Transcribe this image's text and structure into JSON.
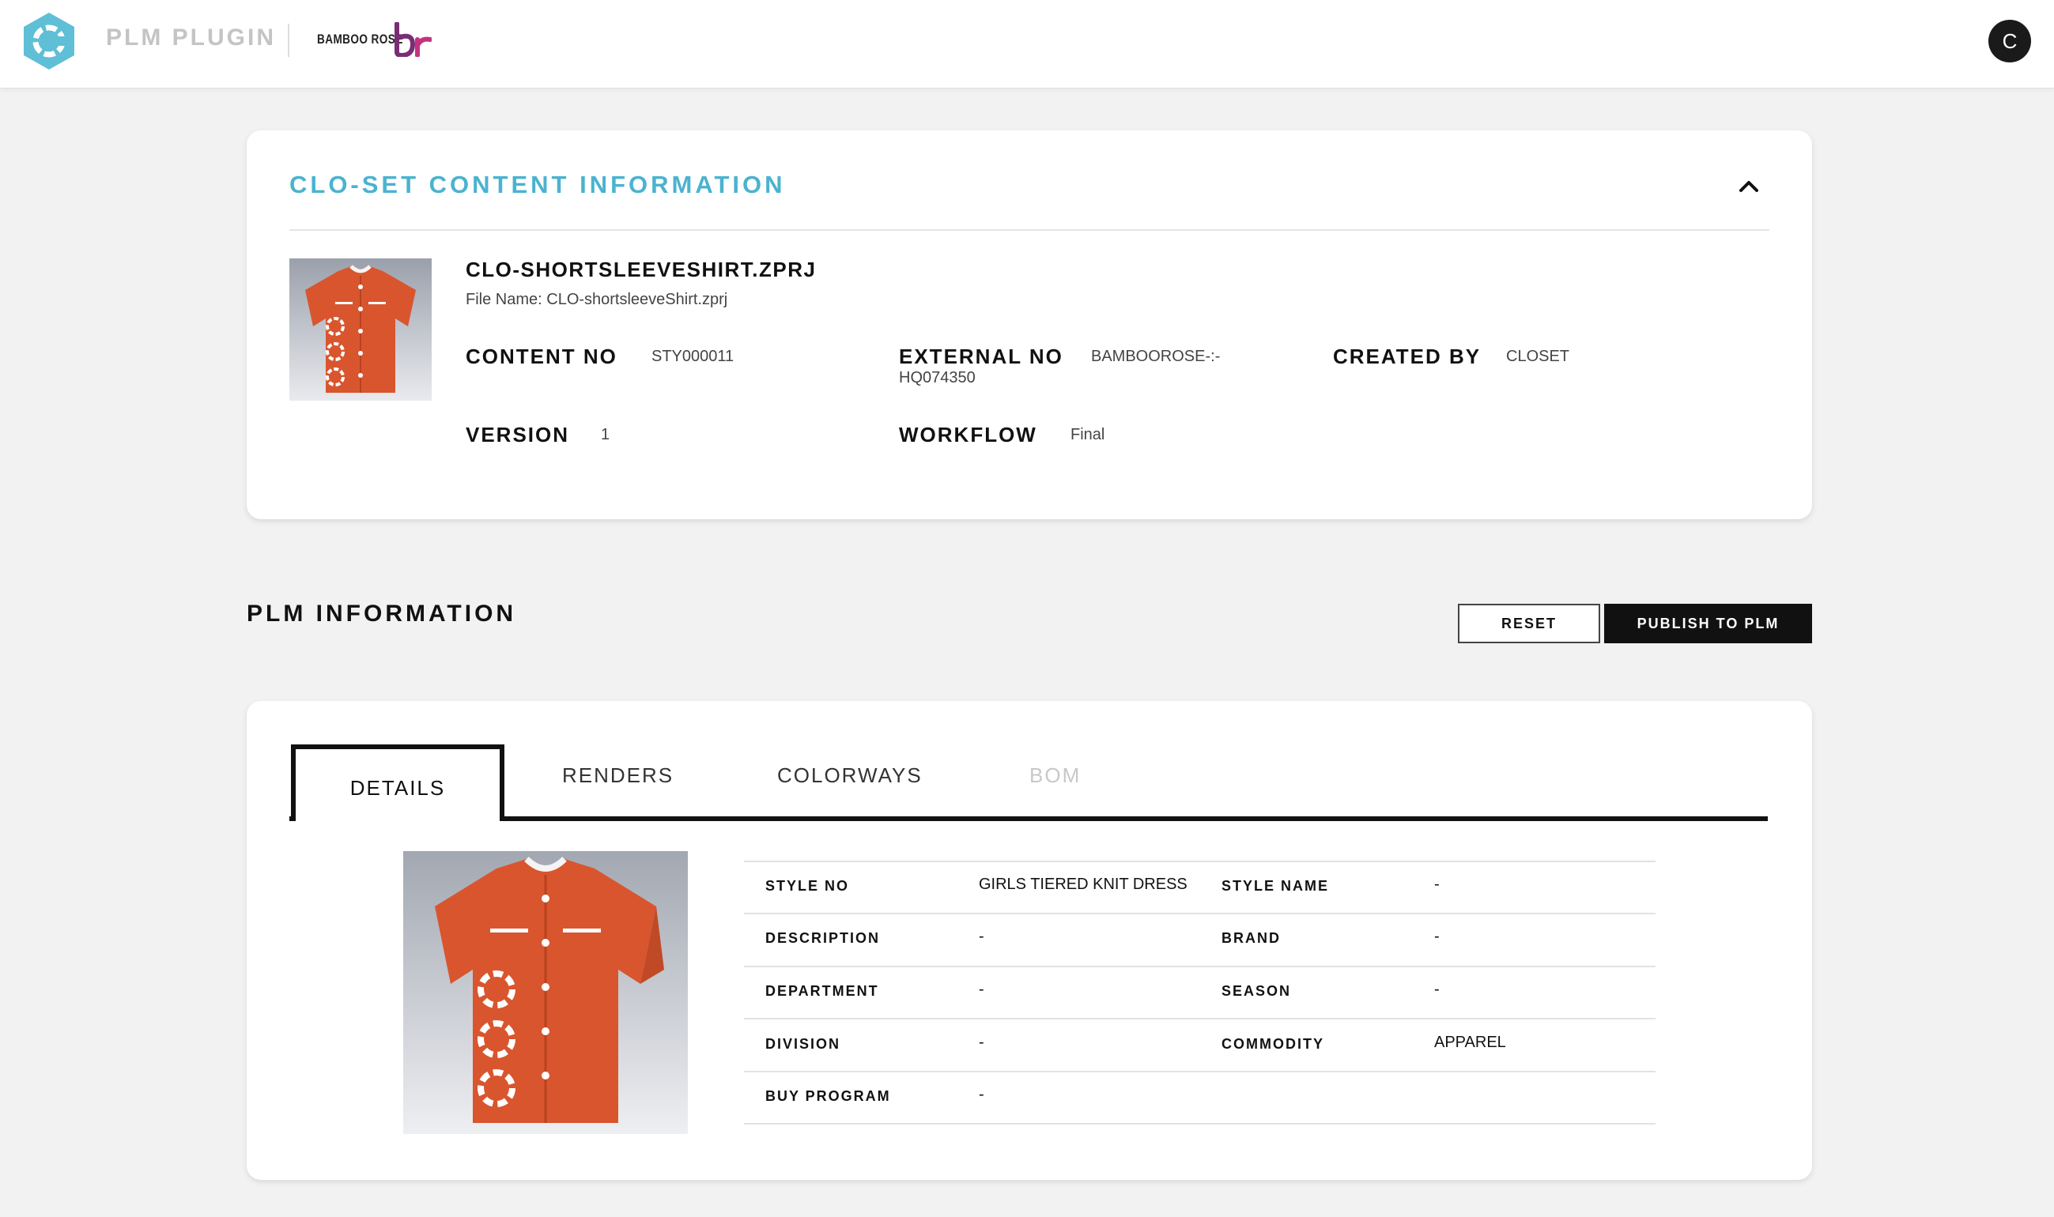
{
  "header": {
    "app_title": "PLM PLUGIN",
    "brand_text": "BAMBOO ROSE",
    "user_initial": "C"
  },
  "content_info": {
    "section_title": "CLO-SET CONTENT INFORMATION",
    "file_heading": "CLO-SHORTSLEEVESHIRT.ZPRJ",
    "file_name": "File Name: CLO-shortsleeveShirt.zprj",
    "content_no_label": "CONTENT NO",
    "content_no_value": "STY000011",
    "external_no_label": "EXTERNAL NO",
    "external_no_value_1": "BAMBOOROSE-:-",
    "external_no_value_2": "HQ074350",
    "created_by_label": "CREATED BY",
    "created_by_value": "CLOSET",
    "version_label": "VERSION",
    "version_value": "1",
    "workflow_label": "WORKFLOW",
    "workflow_value": "Final"
  },
  "plm": {
    "title": "PLM INFORMATION",
    "reset_label": "RESET",
    "publish_label": "PUBLISH TO PLM",
    "tabs": [
      {
        "label": "DETAILS"
      },
      {
        "label": "RENDERS"
      },
      {
        "label": "COLORWAYS"
      },
      {
        "label": "BOM"
      }
    ],
    "details": {
      "style_no_label": "STYLE NO",
      "style_no_value": "GIRLS TIERED KNIT DRESS",
      "style_name_label": "STYLE NAME",
      "style_name_value": "-",
      "description_label": "DESCRIPTION",
      "description_value": "-",
      "brand_label": "BRAND",
      "brand_value": "-",
      "department_label": "DEPARTMENT",
      "department_value": "-",
      "season_label": "SEASON",
      "season_value": "-",
      "division_label": "DIVISION",
      "division_value": "-",
      "commodity_label": "COMMODITY",
      "commodity_value": "APPAREL",
      "buy_program_label": "BUY PROGRAM",
      "buy_program_value": "-"
    }
  },
  "colors": {
    "accent": "#4ab3cf",
    "shirt": "#d9552e",
    "dark": "#111111"
  },
  "icons": {
    "logo": "hexagon-c-logo-icon",
    "brand": "bamboo-rose-br-icon",
    "collapse": "chevron-up-icon"
  }
}
